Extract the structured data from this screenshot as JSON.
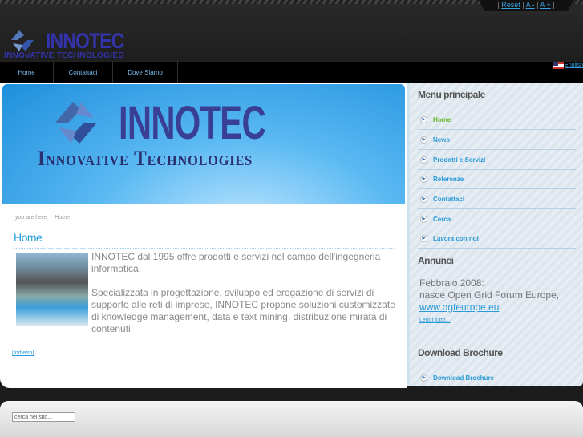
{
  "toolbar": {
    "reset": "Reset",
    "font_smaller": "A -",
    "font_larger": "A +"
  },
  "logo": {
    "name": "INNOTEC",
    "tagline": "Innovative Technologies"
  },
  "nav": [
    {
      "label": "Home"
    },
    {
      "label": "Contattaci"
    },
    {
      "label": "Dove Siamo"
    }
  ],
  "language": {
    "label": "English"
  },
  "banner": {
    "name": "INNOTEC",
    "tagline": "Innovative Technologies"
  },
  "breadcrumb": {
    "prefix": "you are here:",
    "current": "Home"
  },
  "article": {
    "title": "Home",
    "paragraphs": [
      "INNOTEC dal 1995 offre prodotti e servizi nel campo dell'ingegneria informatica.",
      "Specializzata in progettazione, sviluppo ed erogazione di servizi di supporto alle reti di imprese, INNOTEC propone soluzioni customizzate di knowledge management, data e text mining, distribuzione mirata di contenuti."
    ],
    "back": "[Indietro]"
  },
  "sidebar": {
    "menu_title": "Menu principale",
    "menu": [
      {
        "label": "Home"
      },
      {
        "label": "News"
      },
      {
        "label": "Prodotti e Servizi"
      },
      {
        "label": "Referenze"
      },
      {
        "label": "Contattaci"
      },
      {
        "label": "Cerca"
      },
      {
        "label": "Lavora con noi"
      }
    ],
    "ann_title": "Annunci",
    "ann_line1": "Febbraio 2008:",
    "ann_line2": "nasce Open Grid Forum Europe,",
    "ann_link": "www.ogfeurope.eu",
    "ann_more": "Leggi tutto...",
    "dl_title": "Download Brochure",
    "dl_item": "Download Brochure"
  },
  "footer": {
    "search_placeholder": "cerca nel sito..."
  }
}
